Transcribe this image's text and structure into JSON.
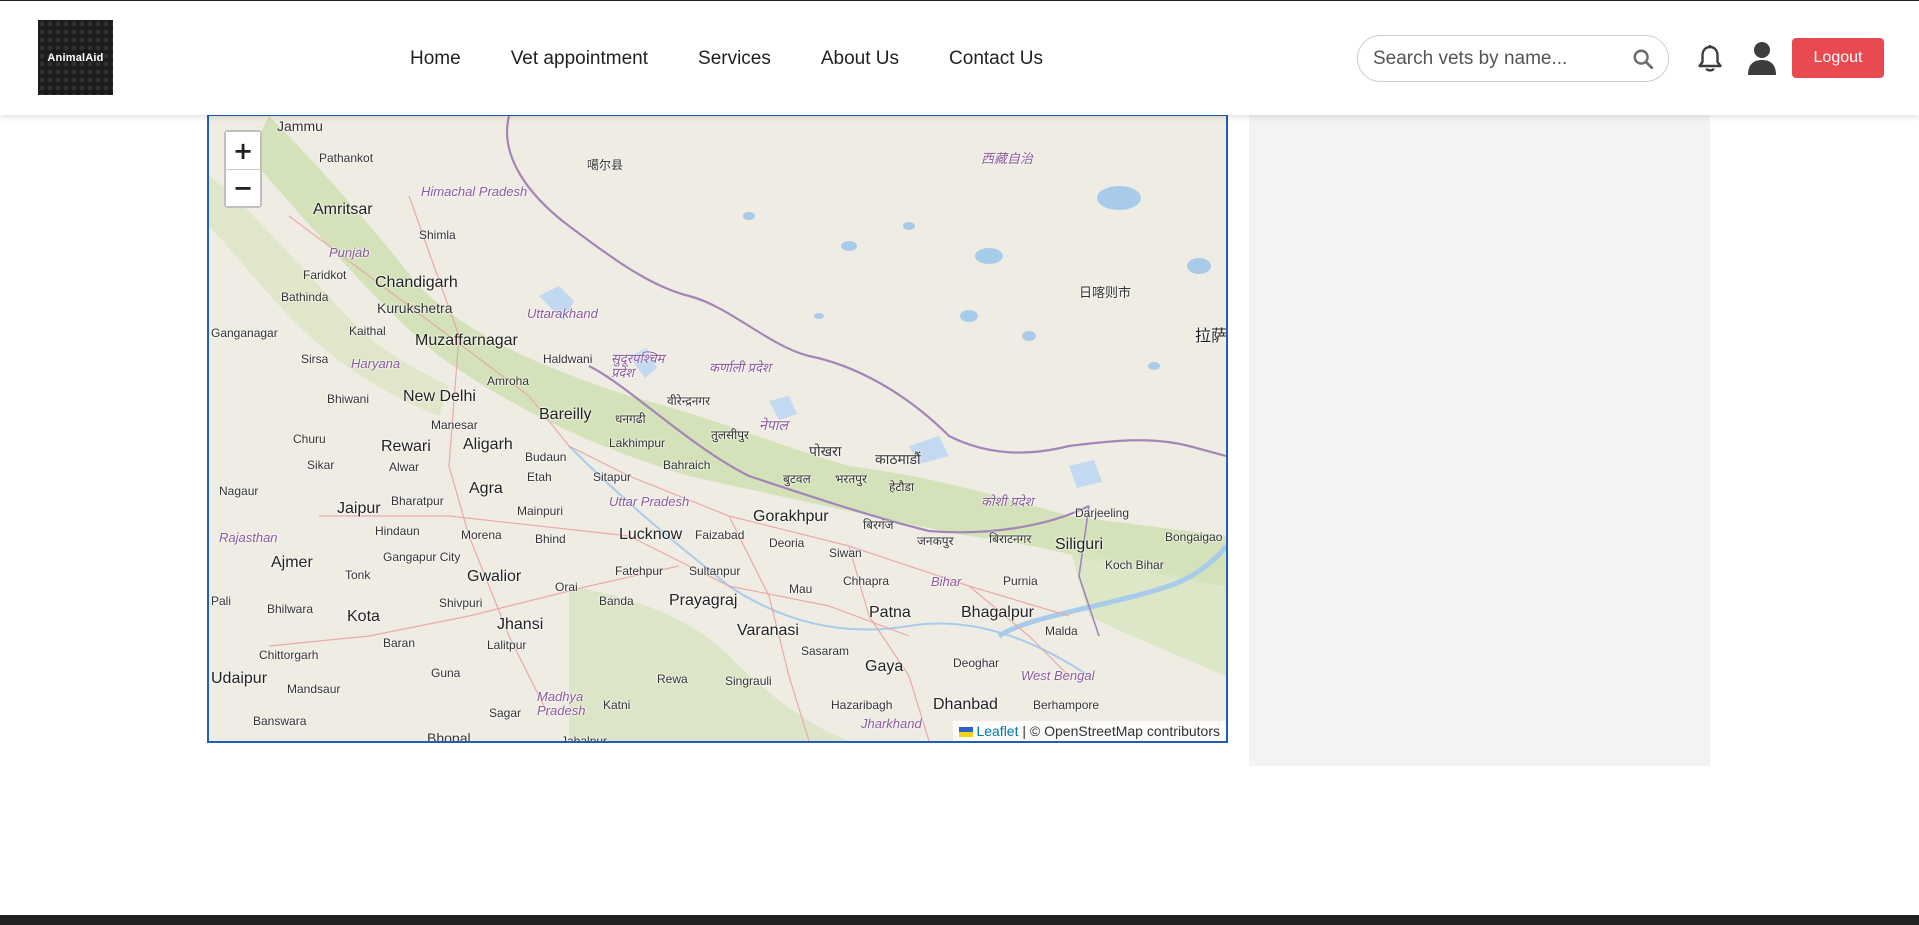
{
  "brand": {
    "logo_text": "AnimalAid"
  },
  "nav": {
    "items": [
      {
        "label": "Home"
      },
      {
        "label": "Vet appointment"
      },
      {
        "label": "Services"
      },
      {
        "label": "About Us"
      },
      {
        "label": "Contact Us"
      }
    ]
  },
  "search": {
    "placeholder": "Search vets by name...",
    "value": "",
    "icon": "search-icon"
  },
  "header_icons": {
    "notifications": "bell-icon",
    "profile": "user-icon"
  },
  "logout": {
    "label": "Logout",
    "color": "#e84a4f"
  },
  "map": {
    "zoom_in_label": "+",
    "zoom_out_label": "−",
    "attribution": {
      "leaflet": "Leaflet",
      "rest": "| © OpenStreetMap contributors"
    },
    "labels": [
      "Jammu",
      "Pathankot",
      "Amritsar",
      "Himachal Pradesh",
      "Shimla",
      "Punjab",
      "Faridkot",
      "Bathinda",
      "Chandigarh",
      "Kurukshetra",
      "Uttarakhand",
      "Ganganagar",
      "Kaithal",
      "Sirsa",
      "Haryana",
      "Muzaffarnagar",
      "Haldwani",
      "Amroha",
      "Bhiwani",
      "New Delhi",
      "Manesar",
      "Bareilly",
      "Churu",
      "Rewari",
      "Aligarh",
      "Budaun",
      "Sikar",
      "Alwar",
      "Etah",
      "Lakhimpur",
      "Sitapur",
      "Bahraich",
      "Nagaur",
      "Bharatpur",
      "Agra",
      "Mainpuri",
      "Uttar Pradesh",
      "Jaipur",
      "Hindaun",
      "Rajasthan",
      "Morena",
      "Bhind",
      "Lucknow",
      "Faizabad",
      "Gorakhpur",
      "Deoria",
      "Siwan",
      "Ajmer",
      "Gangapur City",
      "Tonk",
      "Gwalior",
      "Fatehpur",
      "Sultanpur",
      "Chhapra",
      "Bihar",
      "Purnia",
      "Pali",
      "Bhilwara",
      "Shivpuri",
      "Orai",
      "Banda",
      "Prayagraj",
      "Mau",
      "Patna",
      "Bhagalpur",
      "Kota",
      "Jhansi",
      "Lalitpur",
      "Varanasi",
      "Baran",
      "Chittorgarh",
      "Guna",
      "Sasaram",
      "Gaya",
      "Deoghar",
      "Malda",
      "Udaipur",
      "Mandsaur",
      "Rewa",
      "Singrauli",
      "West Bengal",
      "Madhya Pradesh",
      "Katni",
      "Hazaribagh",
      "Dhanbad",
      "Berhampore",
      "Banswara",
      "Sagar",
      "Jharkhand",
      "Bhopal",
      "Jabalpur",
      "Siliguri",
      "Darjeeling",
      "Koch Bihar",
      "Bongaigao",
      "नेपाल",
      "पोखरा",
      "काठमाडौं",
      "हेटौडा",
      "बुटवल",
      "भरतपुर",
      "तुलसीपुर",
      "वीरेन्द्रनगर",
      "धनगढी",
      "कर्णाली प्रदेश",
      "सुदूरपश्चिम प्रदेश",
      "बिराटनगर",
      "जनकपुर",
      "बिरगंज",
      "कोशी प्रदेश",
      "日喀则市",
      "拉萨",
      "西藏自治",
      "噶尔县"
    ]
  }
}
